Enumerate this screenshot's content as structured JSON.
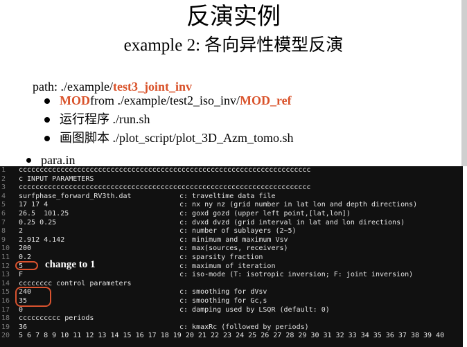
{
  "slide": {
    "title": "反演实例",
    "subtitle": "example 2: 各向异性模型反演",
    "path_prefix": "path: ./example/",
    "path_highlight": "test3_joint_inv",
    "bullets": [
      {
        "parts": [
          {
            "text": "MOD",
            "hl": true
          },
          {
            "text": " from ./example/test2_iso_inv/",
            "hl": false
          },
          {
            "text": "MOD_ref",
            "hl": true
          }
        ]
      },
      {
        "parts": [
          {
            "text": "运行程序 ./run.sh",
            "hl": false
          }
        ]
      },
      {
        "parts": [
          {
            "text": "画图脚本 ./plot_script/plot_3D_Azm_tomo.sh",
            "hl": false
          }
        ]
      }
    ],
    "para_label": "para.in",
    "annotation": "change to  1",
    "colors": {
      "highlight": "#d9522a",
      "code_bg": "#111111",
      "oval": "#d9532f"
    }
  },
  "code": {
    "lines": [
      {
        "n": "1",
        "val": "cccccccccccccccccccccccccccccccccccccccccccccccccccccccccccccccccccccc",
        "cmt": ""
      },
      {
        "n": "2",
        "val": "c INPUT PARAMETERS",
        "cmt": ""
      },
      {
        "n": "3",
        "val": "cccccccccccccccccccccccccccccccccccccccccccccccccccccccccccccccccccccc",
        "cmt": ""
      },
      {
        "n": "4",
        "val": "surfphase_forward_RV3th.dat",
        "cmt": "c: traveltime data file"
      },
      {
        "n": "5",
        "val": "17 17 4",
        "cmt": "c: nx ny nz (grid number in lat lon and depth directions)"
      },
      {
        "n": "6",
        "val": "26.5  101.25",
        "cmt": "c: goxd gozd (upper left point,[lat,lon])"
      },
      {
        "n": "7",
        "val": "0.25 0.25",
        "cmt": "c: dvxd dvzd (grid interval in lat and lon directions)"
      },
      {
        "n": "8",
        "val": "2",
        "cmt": "c: number of sublayers (2~5)"
      },
      {
        "n": "9",
        "val": "2.912 4.142",
        "cmt": "c: minimum and maximum Vsv"
      },
      {
        "n": "10",
        "val": "200",
        "cmt": "c: max(sources, receivers)"
      },
      {
        "n": "11",
        "val": "0.2",
        "cmt": "c: sparsity fraction"
      },
      {
        "n": "12",
        "val": "5",
        "cmt": "c: maximum of iteration"
      },
      {
        "n": "13",
        "val": "F",
        "cmt": "c: iso-mode (T: isotropic inversion; F: joint inversion)"
      },
      {
        "n": "14",
        "val": "cccccccc control parameters",
        "cmt": ""
      },
      {
        "n": "15",
        "val": "240",
        "cmt": "c: smoothing for dVsv"
      },
      {
        "n": "16",
        "val": "35",
        "cmt": "c: smoothing for Gc,s"
      },
      {
        "n": "17",
        "val": "0",
        "cmt": "c: damping used by LSQR (default: 0)"
      },
      {
        "n": "18",
        "val": "cccccccccc periods",
        "cmt": ""
      },
      {
        "n": "19",
        "val": "36",
        "cmt": "c: kmaxRc (followed by periods)"
      },
      {
        "n": "20",
        "val": "5 6 7 8 9 10 11 12 13 14 15 16 17 18 19 20 21 22 23 24 25 26 27 28 29 30 31 32 33 34 35 36 37 38 39 40",
        "cmt": ""
      }
    ]
  }
}
